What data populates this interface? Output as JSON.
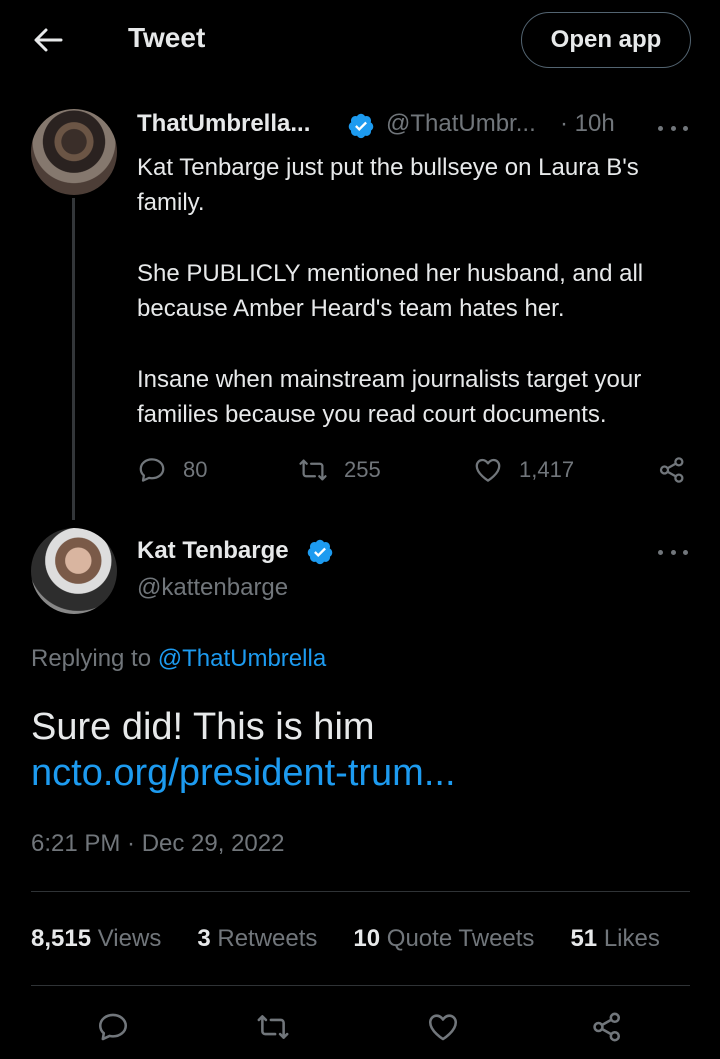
{
  "header": {
    "title": "Tweet",
    "open_app_label": "Open app"
  },
  "parent_tweet": {
    "name": "ThatUmbrella...",
    "handle": "@ThatUmbr...",
    "time": "· 10h",
    "paragraphs": [
      "Kat Tenbarge just put the bullseye on Laura B's family.",
      "She PUBLICLY mentioned her husband, and all because Amber Heard's team hates her.",
      "Insane when mainstream journalists target your families because you read court documents."
    ],
    "replies": "80",
    "retweets": "255",
    "likes": "1,417"
  },
  "main_tweet": {
    "name": "Kat Tenbarge",
    "handle": "@kattenbarge",
    "replying_prefix": "Replying to",
    "replying_to": "@ThatUmbrella",
    "text": "Sure did! This is him",
    "link": "ncto.org/president-trum...",
    "timestamp": "6:21 PM · Dec 29, 2022"
  },
  "stats": {
    "views_num": "8,515",
    "views_label": "Views",
    "retweets_num": "3",
    "retweets_label": "Retweets",
    "quotes_num": "10",
    "quotes_label": "Quote Tweets",
    "likes_num": "51",
    "likes_label": "Likes"
  },
  "colors": {
    "accent": "#1d9bf0",
    "muted": "#71767b",
    "text": "#e7e9ea",
    "background": "#000000"
  }
}
